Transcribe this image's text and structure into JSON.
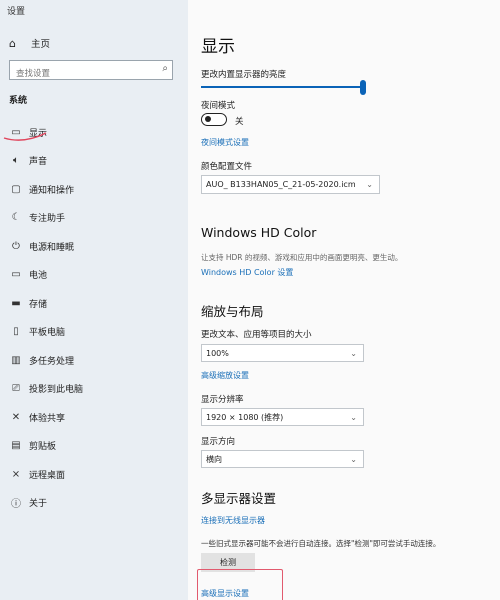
{
  "window_title": "设置",
  "sidebar": {
    "home": {
      "icon": "home-icon",
      "label": "主页"
    },
    "search_placeholder": "查找设置",
    "section": "系统",
    "items": [
      {
        "icon": "monitor-icon",
        "label": "显示",
        "active": true
      },
      {
        "icon": "speaker-icon",
        "label": "声音"
      },
      {
        "icon": "notification-icon",
        "label": "通知和操作"
      },
      {
        "icon": "moon-icon",
        "label": "专注助手"
      },
      {
        "icon": "power-icon",
        "label": "电源和睡眠"
      },
      {
        "icon": "battery-icon",
        "label": "电池"
      },
      {
        "icon": "storage-icon",
        "label": "存储"
      },
      {
        "icon": "tablet-icon",
        "label": "平板电脑"
      },
      {
        "icon": "multitask-icon",
        "label": "多任务处理"
      },
      {
        "icon": "project-icon",
        "label": "投影到此电脑"
      },
      {
        "icon": "share-icon",
        "label": "体验共享"
      },
      {
        "icon": "clipboard-icon",
        "label": "剪贴板"
      },
      {
        "icon": "remote-desktop-icon",
        "label": "远程桌面"
      },
      {
        "icon": "info-icon",
        "label": "关于"
      }
    ]
  },
  "main": {
    "title": "显示",
    "brightness_label": "更改内置显示器的亮度",
    "brightness_value": 1.0,
    "night_mode_label": "夜间模式",
    "night_mode_state": "关",
    "night_mode_link": "夜间模式设置",
    "color_profile_label": "颜色配置文件",
    "color_profile_value": "AUO_        B133HAN05_C_21-05-2020.icm",
    "hd_color_title": "Windows HD Color",
    "hd_color_desc": "让支持 HDR 的视频、游戏和应用中的画面更明亮、更生动。",
    "hd_color_link": "Windows HD Color 设置",
    "scale_title": "缩放与布局",
    "scale_label": "更改文本、应用等项目的大小",
    "scale_value": "100%",
    "advanced_scale_link": "高级缩放设置",
    "resolution_label": "显示分辨率",
    "resolution_value": "1920 × 1080 (推荐)",
    "orientation_label": "显示方向",
    "orientation_value": "横向",
    "multi_title": "多显示器设置",
    "wireless_link": "连接到无线显示器",
    "multi_desc": "一些旧式显示器可能不会进行自动连接。选择\"检测\"即可尝试手动连接。",
    "detect_button": "检测",
    "advanced_display_link": "高级显示设置"
  }
}
